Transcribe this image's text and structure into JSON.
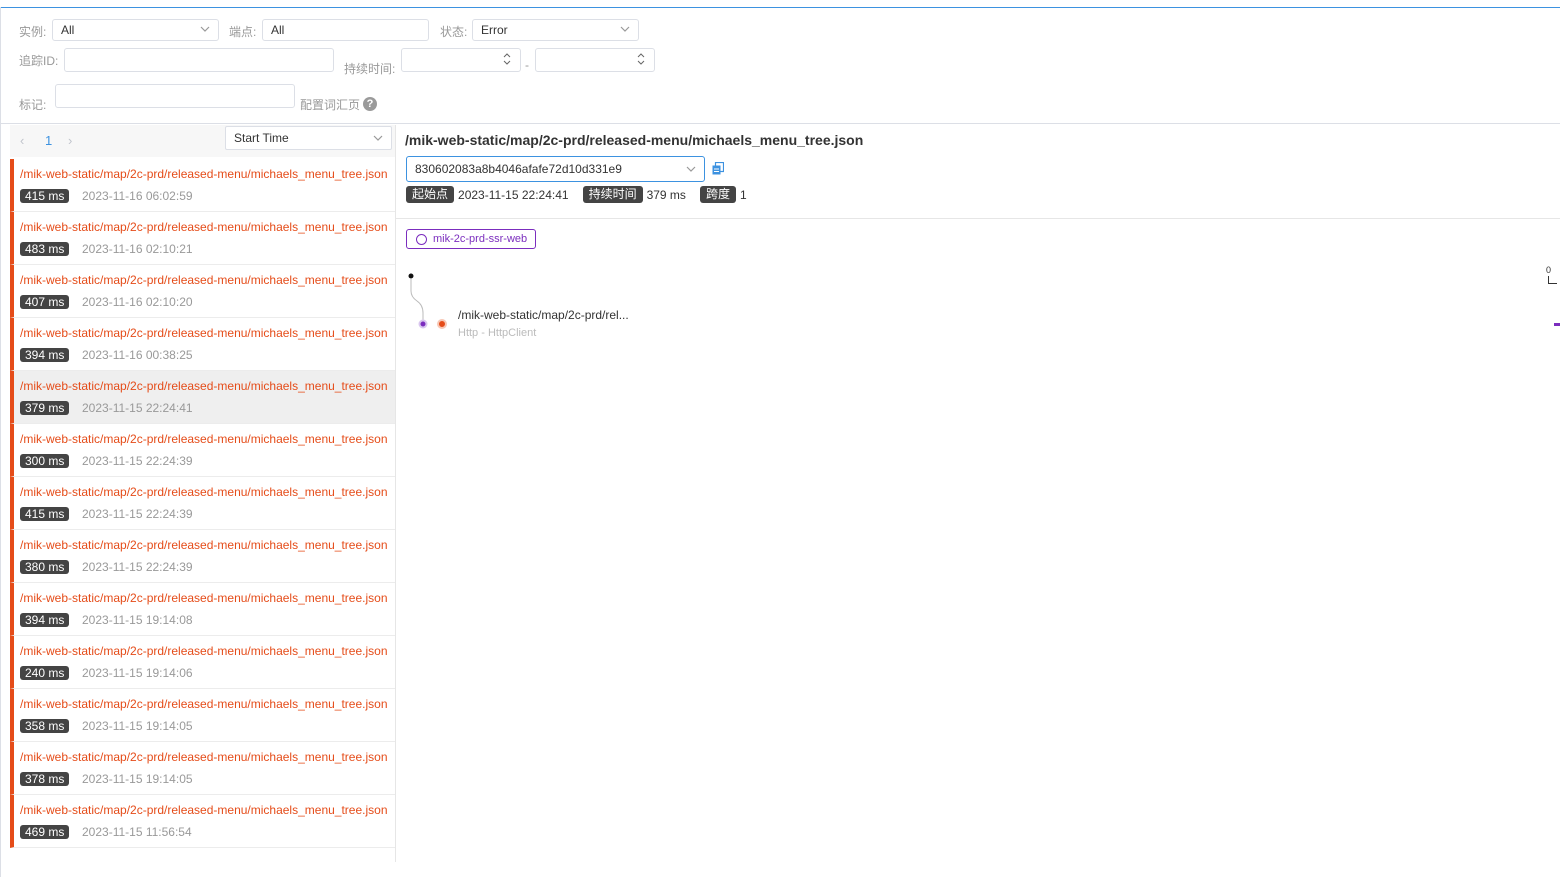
{
  "filters": {
    "instance_label": "实例:",
    "instance_value": "All",
    "endpoint_label": "端点:",
    "endpoint_value": "All",
    "status_label": "状态:",
    "status_value": "Error",
    "trace_id_label": "追踪ID:",
    "trace_id_value": "",
    "duration_label": "持续时间:",
    "duration_min": "",
    "duration_separator": "-",
    "duration_max": "",
    "tags_label": "标记:",
    "tags_value": "",
    "vocab_link": "配置词汇页",
    "help_glyph": "?"
  },
  "list": {
    "pager": {
      "prev": "‹",
      "page": "1",
      "next": "›"
    },
    "sort_value": "Start Time",
    "selected_index": 4,
    "items": [
      {
        "endpoint": "/mik-web-static/map/2c-prd/released-menu/michaels_menu_tree.json",
        "duration": "415 ms",
        "time": "2023-11-16 06:02:59"
      },
      {
        "endpoint": "/mik-web-static/map/2c-prd/released-menu/michaels_menu_tree.json",
        "duration": "483 ms",
        "time": "2023-11-16 02:10:21"
      },
      {
        "endpoint": "/mik-web-static/map/2c-prd/released-menu/michaels_menu_tree.json",
        "duration": "407 ms",
        "time": "2023-11-16 02:10:20"
      },
      {
        "endpoint": "/mik-web-static/map/2c-prd/released-menu/michaels_menu_tree.json",
        "duration": "394 ms",
        "time": "2023-11-16 00:38:25"
      },
      {
        "endpoint": "/mik-web-static/map/2c-prd/released-menu/michaels_menu_tree.json",
        "duration": "379 ms",
        "time": "2023-11-15 22:24:41"
      },
      {
        "endpoint": "/mik-web-static/map/2c-prd/released-menu/michaels_menu_tree.json",
        "duration": "300 ms",
        "time": "2023-11-15 22:24:39"
      },
      {
        "endpoint": "/mik-web-static/map/2c-prd/released-menu/michaels_menu_tree.json",
        "duration": "415 ms",
        "time": "2023-11-15 22:24:39"
      },
      {
        "endpoint": "/mik-web-static/map/2c-prd/released-menu/michaels_menu_tree.json",
        "duration": "380 ms",
        "time": "2023-11-15 22:24:39"
      },
      {
        "endpoint": "/mik-web-static/map/2c-prd/released-menu/michaels_menu_tree.json",
        "duration": "394 ms",
        "time": "2023-11-15 19:14:08"
      },
      {
        "endpoint": "/mik-web-static/map/2c-prd/released-menu/michaels_menu_tree.json",
        "duration": "240 ms",
        "time": "2023-11-15 19:14:06"
      },
      {
        "endpoint": "/mik-web-static/map/2c-prd/released-menu/michaels_menu_tree.json",
        "duration": "358 ms",
        "time": "2023-11-15 19:14:05"
      },
      {
        "endpoint": "/mik-web-static/map/2c-prd/released-menu/michaels_menu_tree.json",
        "duration": "378 ms",
        "time": "2023-11-15 19:14:05"
      },
      {
        "endpoint": "/mik-web-static/map/2c-prd/released-menu/michaels_menu_tree.json",
        "duration": "469 ms",
        "time": "2023-11-15 11:56:54"
      }
    ]
  },
  "detail": {
    "title": "/mik-web-static/map/2c-prd/released-menu/michaels_menu_tree.json",
    "trace_id": "830602083a8b4046afafe72d10d331e9",
    "start_label": "起始点",
    "start_value": "2023-11-15 22:24:41",
    "duration_label": "持续时间",
    "duration_value": "379 ms",
    "span_label": "跨度",
    "span_value": "1",
    "service": "mik-2c-prd-ssr-web",
    "span_name": "/mik-web-static/map/2c-prd/rel...",
    "span_component": "Http - HttpClient",
    "scale_zero": "0"
  },
  "colors": {
    "error": "#e54c19",
    "accent": "#3d92e0",
    "service": "#7b2dbe",
    "tag_bg": "#444444"
  },
  "icons": [
    "chevron-down-icon",
    "spinner-arrows-icon",
    "help-icon",
    "copy-icon",
    "ring-icon"
  ]
}
